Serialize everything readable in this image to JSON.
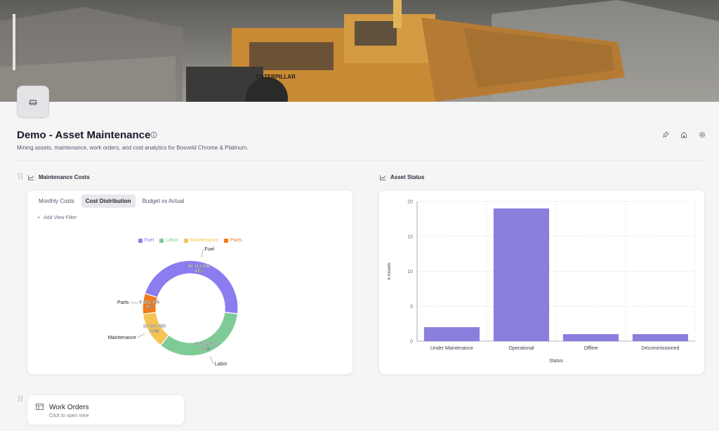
{
  "header": {
    "title": "Demo - Asset Maintenance",
    "subtitle": "Mining assets, maintenance, work orders, and cost analytics for Bosveld Chrome & Platinum.",
    "banner_truck_text": "CATERPILLAR"
  },
  "actions": {
    "icons": [
      "pin-icon",
      "home-icon",
      "settings-icon"
    ]
  },
  "maintenance_costs": {
    "title": "Maintenance Costs",
    "tabs": [
      "Monthly Costs",
      "Cost Distribution",
      "Budget vs Actual"
    ],
    "active_tab": "Cost Distribution",
    "add_filter_label": "Add View Filter"
  },
  "asset_status": {
    "title": "Asset Status"
  },
  "work_orders": {
    "title": "Work Orders",
    "subtitle": "Click to open view"
  },
  "colors": {
    "fuel": "#8b7cf0",
    "labor": "#7ecb98",
    "maintenance": "#f6c453",
    "parts": "#f07a1c",
    "bar": "#8a7fdc"
  },
  "chart_data": [
    {
      "type": "pie",
      "variant": "donut",
      "legend_position": "top",
      "legend": [
        "Fuel",
        "Labor",
        "Maintenance",
        "Parts"
      ],
      "slices": [
        {
          "name": "Fuel",
          "value": 46113900,
          "value_label": "46 113 900",
          "percent_label": "47%"
        },
        {
          "name": "Labor",
          "value": 33289500,
          "value_label": "33 289 500",
          "percent_label": "34%"
        },
        {
          "name": "Maintenance",
          "value": 12124850,
          "value_label": "12 124 850",
          "percent_label": "12%"
        },
        {
          "name": "Parts",
          "value": 6842700,
          "value_label": "6 842 700",
          "percent_label": "7%"
        }
      ]
    },
    {
      "type": "bar",
      "categories": [
        "Under Maintenance",
        "Operational",
        "Offline",
        "Decommissioned"
      ],
      "values": [
        2,
        19,
        1,
        1
      ],
      "xlabel": "Status",
      "ylabel": "# Assets",
      "ylim": [
        0,
        20
      ],
      "yticks": [
        0,
        5,
        10,
        15,
        20
      ],
      "grid": true
    }
  ]
}
